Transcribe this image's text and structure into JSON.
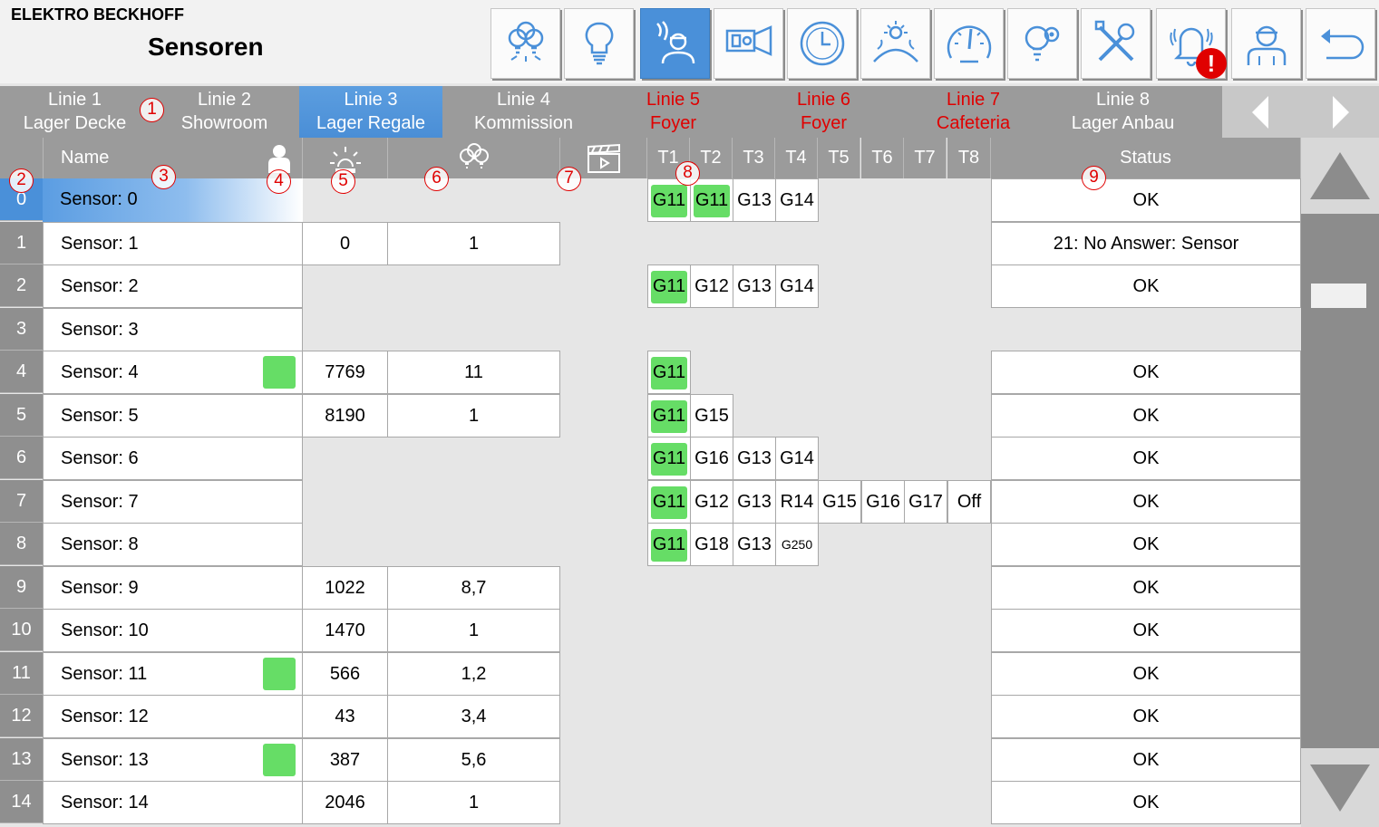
{
  "header": {
    "company": "ELEKTRO BECKHOFF",
    "title": "Sensoren"
  },
  "toolbar": [
    {
      "icon": "light-groups-icon"
    },
    {
      "icon": "bulb-icon"
    },
    {
      "icon": "presence-sensor-icon",
      "active": true
    },
    {
      "icon": "projector-icon"
    },
    {
      "icon": "clock-icon"
    },
    {
      "icon": "sun-moon-icon"
    },
    {
      "icon": "gauge-icon"
    },
    {
      "icon": "light-settings-icon"
    },
    {
      "icon": "tools-icon"
    },
    {
      "icon": "alarm-bell-icon",
      "badge": "!"
    },
    {
      "icon": "user-icon"
    },
    {
      "icon": "back-icon"
    }
  ],
  "tabs": [
    {
      "line1": "Linie 1",
      "line2": "Lager Decke",
      "state": "normal"
    },
    {
      "line1": "Linie 2",
      "line2": "Showroom",
      "state": "normal"
    },
    {
      "line1": "Linie 3",
      "line2": "Lager Regale",
      "state": "active"
    },
    {
      "line1": "Linie 4",
      "line2": "Kommission",
      "state": "normal"
    },
    {
      "line1": "Linie 5",
      "line2": "Foyer",
      "state": "alarm"
    },
    {
      "line1": "Linie 6",
      "line2": "Foyer",
      "state": "alarm"
    },
    {
      "line1": "Linie 7",
      "line2": "Cafeteria",
      "state": "alarm"
    },
    {
      "line1": "Linie 8",
      "line2": "Lager Anbau",
      "state": "normal"
    }
  ],
  "columns": {
    "name": "Name",
    "presence_icon": "person-icon",
    "brightness_icon": "sun-icon",
    "groups_icon": "light-groups-icon",
    "scene_icon": "clapperboard-icon",
    "t": [
      "T1",
      "T2",
      "T3",
      "T4",
      "T5",
      "T6",
      "T7",
      "T8"
    ],
    "status": "Status"
  },
  "markers": [
    "1",
    "2",
    "3",
    "4",
    "5",
    "6",
    "7",
    "8",
    "9"
  ],
  "rows": [
    {
      "nr": "0",
      "name": "Sensor: 0",
      "selected": true,
      "presence": false,
      "lux": null,
      "factor": null,
      "t": [
        "G11",
        "G11",
        "G13",
        "G14"
      ],
      "t_green": [
        true,
        true,
        false,
        false
      ],
      "status": "OK"
    },
    {
      "nr": "1",
      "name": "Sensor: 1",
      "presence": false,
      "lux": "0",
      "factor": "1",
      "t": [],
      "t_green": [],
      "status": "21: No Answer: Sensor"
    },
    {
      "nr": "2",
      "name": "Sensor: 2",
      "presence": false,
      "lux": null,
      "factor": null,
      "t": [
        "G11",
        "G12",
        "G13",
        "G14"
      ],
      "t_green": [
        true,
        false,
        false,
        false
      ],
      "status": "OK"
    },
    {
      "nr": "3",
      "name": "Sensor: 3",
      "presence": false,
      "lux": null,
      "factor": null,
      "t": [],
      "t_green": [],
      "status": null
    },
    {
      "nr": "4",
      "name": "Sensor: 4",
      "presence": true,
      "lux": "7769",
      "factor": "11",
      "t": [
        "G11"
      ],
      "t_green": [
        true
      ],
      "status": "OK"
    },
    {
      "nr": "5",
      "name": "Sensor: 5",
      "presence": false,
      "lux": "8190",
      "factor": "1",
      "t": [
        "G11",
        "G15"
      ],
      "t_green": [
        true,
        false
      ],
      "status": "OK"
    },
    {
      "nr": "6",
      "name": "Sensor: 6",
      "presence": false,
      "lux": null,
      "factor": null,
      "t": [
        "G11",
        "G16",
        "G13",
        "G14"
      ],
      "t_green": [
        true,
        false,
        false,
        false
      ],
      "status": "OK"
    },
    {
      "nr": "7",
      "name": "Sensor: 7",
      "presence": false,
      "lux": null,
      "factor": null,
      "t": [
        "G11",
        "G12",
        "G13",
        "R14",
        "G15",
        "G16",
        "G17",
        "Off"
      ],
      "t_green": [
        true,
        false,
        false,
        false,
        false,
        false,
        false,
        false
      ],
      "status": "OK"
    },
    {
      "nr": "8",
      "name": "Sensor: 8",
      "presence": false,
      "lux": null,
      "factor": null,
      "t": [
        "G11",
        "G18",
        "G13",
        "G250"
      ],
      "t_green": [
        true,
        false,
        false,
        false
      ],
      "status": "OK"
    },
    {
      "nr": "9",
      "name": "Sensor: 9",
      "presence": false,
      "lux": "1022",
      "factor": "8,7",
      "t": [],
      "t_green": [],
      "status": "OK"
    },
    {
      "nr": "10",
      "name": "Sensor: 10",
      "presence": false,
      "lux": "1470",
      "factor": "1",
      "t": [],
      "t_green": [],
      "status": "OK"
    },
    {
      "nr": "11",
      "name": "Sensor: 11",
      "presence": true,
      "lux": "566",
      "factor": "1,2",
      "t": [],
      "t_green": [],
      "status": "OK"
    },
    {
      "nr": "12",
      "name": "Sensor: 12",
      "presence": false,
      "lux": "43",
      "factor": "3,4",
      "t": [],
      "t_green": [],
      "status": "OK"
    },
    {
      "nr": "13",
      "name": "Sensor: 13",
      "presence": true,
      "lux": "387",
      "factor": "5,6",
      "t": [],
      "t_green": [],
      "status": "OK"
    },
    {
      "nr": "14",
      "name": "Sensor: 14",
      "presence": false,
      "lux": "2046",
      "factor": "1",
      "t": [],
      "t_green": [],
      "status": "OK"
    }
  ],
  "colors": {
    "accent": "#4a90d9",
    "presence_on": "#66dd66",
    "alarm": "#e00000",
    "header_bg": "#9b9b9b"
  }
}
